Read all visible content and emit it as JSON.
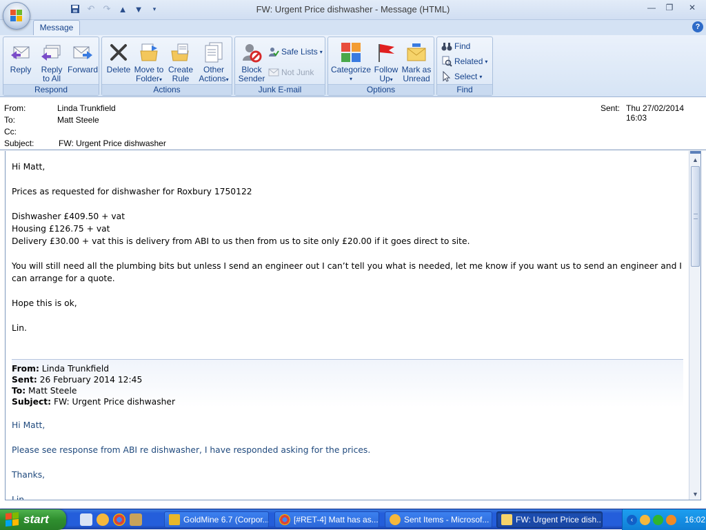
{
  "window": {
    "title": "FW: Urgent Price dishwasher  - Message (HTML)"
  },
  "ribbon": {
    "tab": "Message",
    "groups": {
      "respond": {
        "label": "Respond",
        "reply": "Reply",
        "reply_all_1": "Reply",
        "reply_all_2": "to All",
        "forward": "Forward"
      },
      "actions": {
        "label": "Actions",
        "delete": "Delete",
        "move_1": "Move to",
        "move_2": "Folder",
        "rule_1": "Create",
        "rule_2": "Rule",
        "other_1": "Other",
        "other_2": "Actions"
      },
      "junk": {
        "label": "Junk E-mail",
        "block_1": "Block",
        "block_2": "Sender",
        "safe_lists": "Safe Lists",
        "not_junk": "Not Junk"
      },
      "options": {
        "label": "Options",
        "categorize": "Categorize",
        "follow_1": "Follow",
        "follow_2": "Up",
        "mark_1": "Mark as",
        "mark_2": "Unread"
      },
      "find": {
        "label": "Find",
        "find": "Find",
        "related": "Related",
        "select": "Select"
      }
    }
  },
  "header": {
    "from_label": "From:",
    "from": "Linda Trunkfield",
    "to_label": "To:",
    "to": "Matt Steele",
    "cc_label": "Cc:",
    "subject_label": "Subject:",
    "subject": "FW: Urgent Price dishwasher",
    "sent_label": "Sent:",
    "sent": "Thu 27/02/2014 16:03"
  },
  "message": {
    "greeting": "Hi Matt,",
    "intro": "Prices as requested for dishwasher for Roxbury 1750122",
    "price_1": "Dishwasher £409.50 + vat",
    "price_2": "Housing £126.75 + vat",
    "price_3": "Delivery £30.00 + vat this is delivery from ABI to us then from us to site only £20.00 if it goes direct to site.",
    "para": "You will still need all the plumbing bits but unless I send an engineer out I can’t tell you what is needed, let me know if you want us to send an engineer and I can arrange for a quote.",
    "closing": "Hope this is ok,",
    "sign": "Lin."
  },
  "forwarded": {
    "from_label": "From:",
    "from": "Linda Trunkfield",
    "sent_label": "Sent:",
    "sent": "26 February 2014 12:45",
    "to_label": "To:",
    "to": "Matt Steele",
    "subject_label": "Subject:",
    "subject": "FW: Urgent Price dishwasher",
    "greeting": "Hi Matt,",
    "body": "Please see response from ABI re dishwasher, I have responded asking for the prices.",
    "thanks": "Thanks,",
    "sign": "Lin."
  },
  "taskbar": {
    "start": "start",
    "items": [
      {
        "label": "GoldMine 6.7 (Corpor..."
      },
      {
        "label": "[#RET-4] Matt has as..."
      },
      {
        "label": "Sent Items - Microsof..."
      },
      {
        "label": "FW: Urgent Price dish..."
      }
    ],
    "clock": "16:02"
  }
}
